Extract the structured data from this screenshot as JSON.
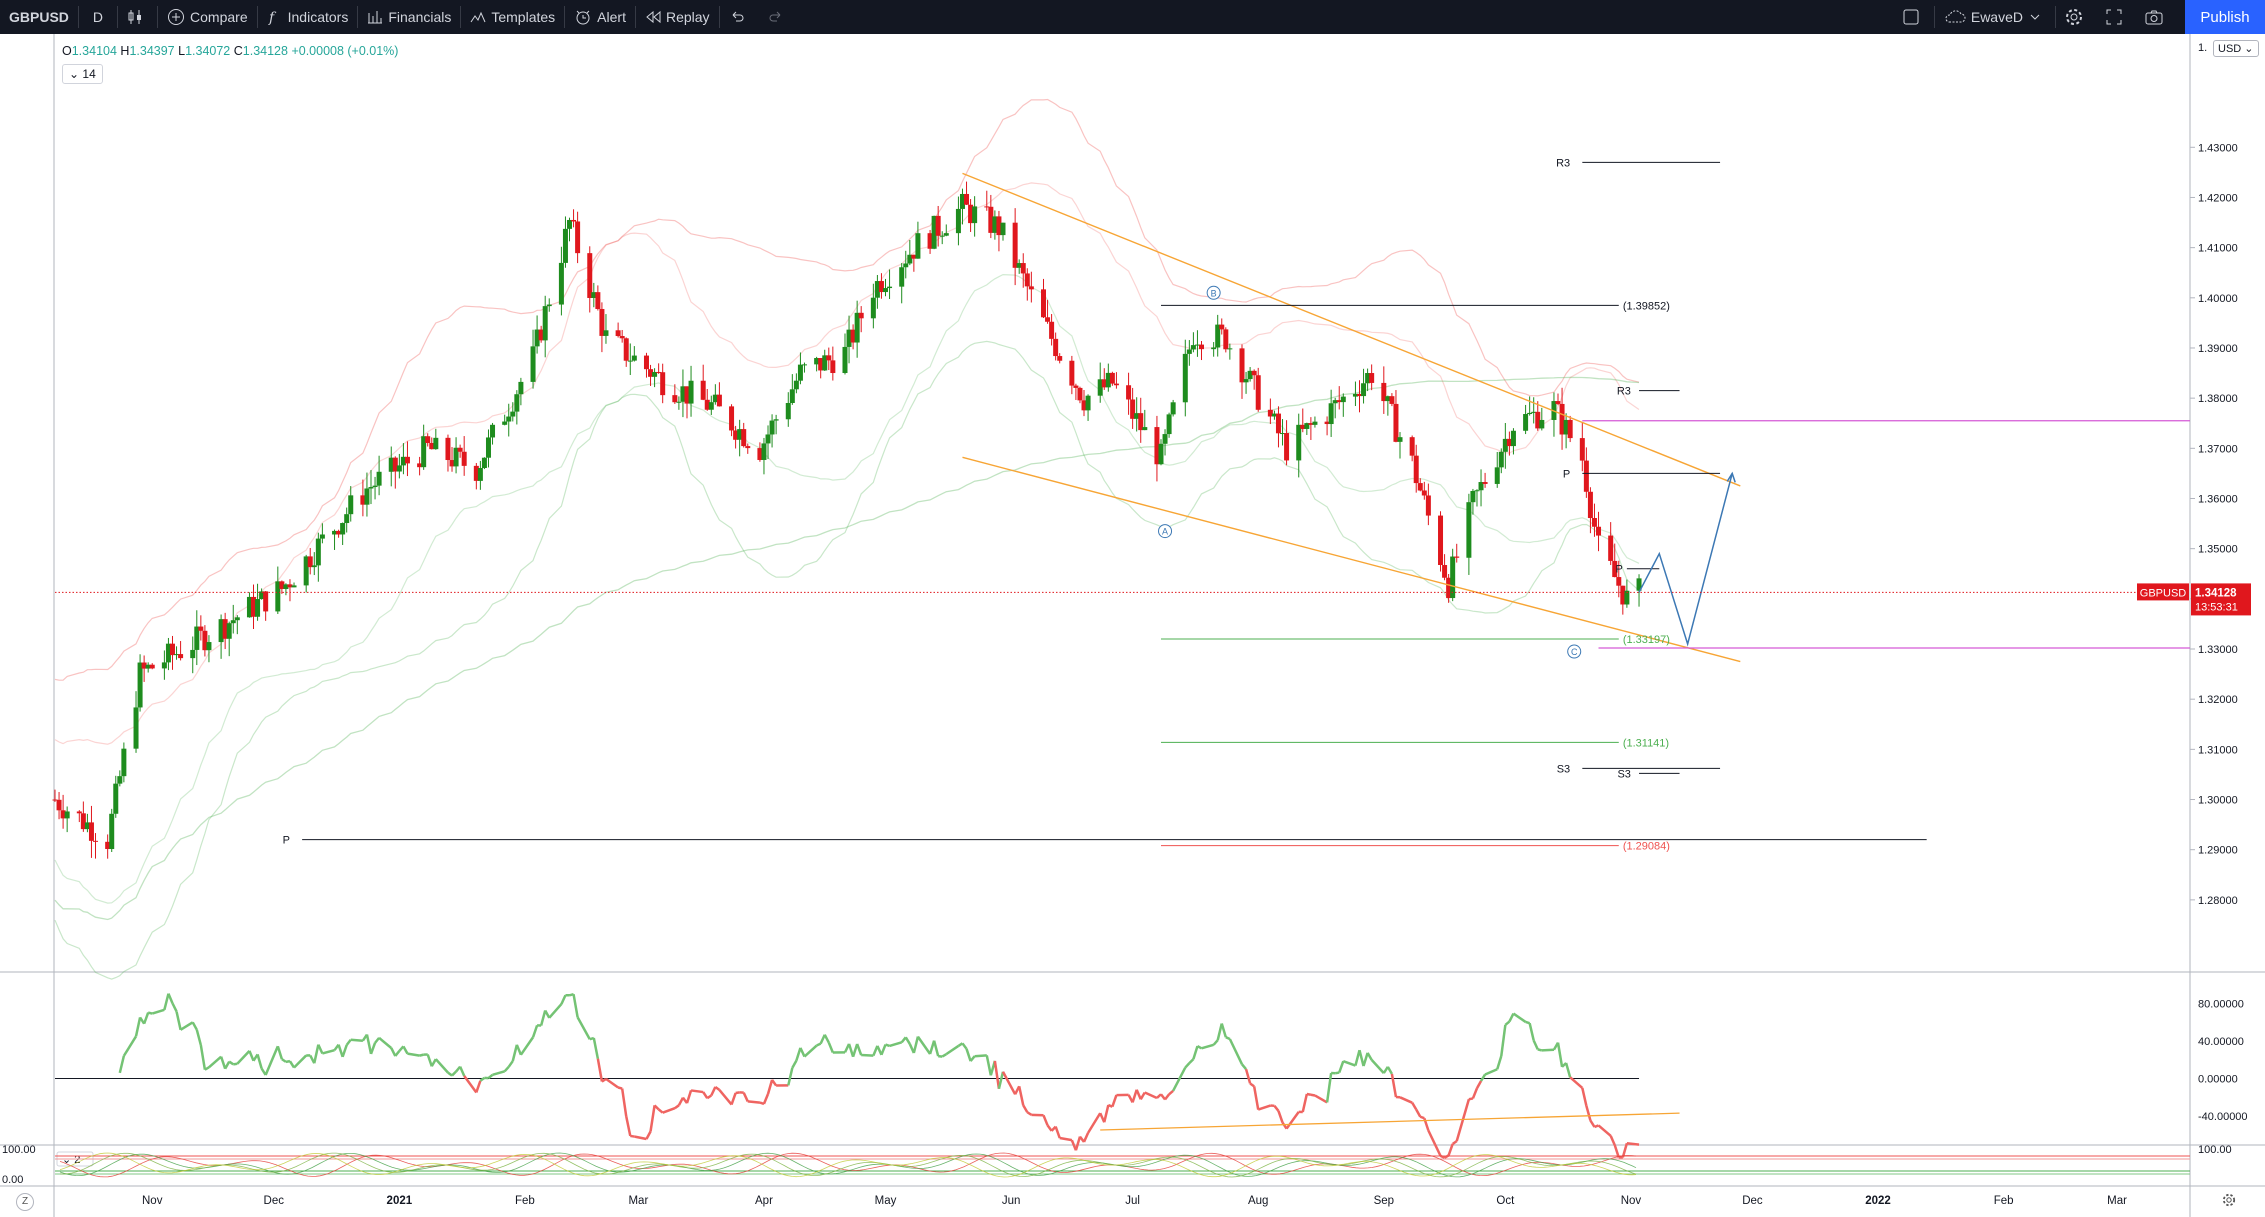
{
  "topbar": {
    "symbol": "GBPUSD",
    "interval": "D",
    "compare": "Compare",
    "indicators": "Indicators",
    "financials": "Financials",
    "templates": "Templates",
    "alert": "Alert",
    "replay": "Replay",
    "layout_name": "EwaveD",
    "publish": "Publish"
  },
  "legend": {
    "o": "1.34104",
    "h": "1.34397",
    "l": "1.34072",
    "c": "1.34128",
    "change": "+0.00008 (+0.01%)",
    "indicator_badge": "14"
  },
  "price_axis": {
    "currency": "USD",
    "top_label": "1.",
    "ticks": [
      "1.43000",
      "1.42000",
      "1.41000",
      "1.40000",
      "1.39000",
      "1.38000",
      "1.37000",
      "1.36000",
      "1.35000",
      "1.34000",
      "1.33000",
      "1.32000",
      "1.31000",
      "1.30000",
      "1.29000",
      "1.28000"
    ],
    "last_symbol": "GBPUSD",
    "last_price": "1.34128",
    "countdown": "13:53:31"
  },
  "time_axis": [
    "Nov",
    "Dec",
    "2021",
    "Feb",
    "Mar",
    "Apr",
    "May",
    "Jun",
    "Jul",
    "Aug",
    "Sep",
    "Oct",
    "Nov",
    "Dec",
    "2022",
    "Feb",
    "Mar"
  ],
  "annotations": {
    "wave_labels": [
      "A",
      "B",
      "C"
    ],
    "fib_levels": [
      "(1.39852)",
      "(1.33197)",
      "(1.31141)",
      "(1.29084)"
    ],
    "pivot_labels": [
      "R3",
      "R3",
      "P",
      "P",
      "P",
      "S3",
      "S3"
    ]
  },
  "rsi_axis": [
    "80.00000",
    "40.00000",
    "0.00000",
    "-40.00000"
  ],
  "stoch_axis": {
    "left_top": "100.00",
    "left_bottom": "0.00",
    "right_top": "100.00",
    "badge": "2"
  },
  "controls": {
    "zoom_label": "Z",
    "settings_icon": "gear-icon"
  },
  "colors": {
    "up": "#1e8c1e",
    "down": "#e0171d",
    "channel": "#f7a535",
    "projection": "#3c78b4",
    "magenta": "#d55ad6",
    "rsi_up": "#74c374",
    "rsi_down": "#ef6461",
    "price_tag": "#e0171d"
  },
  "chart_data": {
    "type": "candlestick",
    "x_range": [
      "2020-10-20",
      "2022-03-31"
    ],
    "ylim": [
      1.272,
      1.447
    ],
    "series": [
      {
        "name": "GBPUSD",
        "close_path": [
          [
            "2020-10-20",
            1.3
          ],
          [
            "2020-11-02",
            1.292
          ],
          [
            "2020-11-10",
            1.325
          ],
          [
            "2020-12-01",
            1.335
          ],
          [
            "2020-12-15",
            1.342
          ],
          [
            "2021-01-05",
            1.362
          ],
          [
            "2021-01-20",
            1.37
          ],
          [
            "2021-02-01",
            1.366
          ],
          [
            "2021-02-15",
            1.388
          ],
          [
            "2021-02-24",
            1.415
          ],
          [
            "2021-03-05",
            1.392
          ],
          [
            "2021-03-20",
            1.383
          ],
          [
            "2021-04-01",
            1.378
          ],
          [
            "2021-04-12",
            1.37
          ],
          [
            "2021-04-22",
            1.385
          ],
          [
            "2021-05-03",
            1.389
          ],
          [
            "2021-05-10",
            1.402
          ],
          [
            "2021-05-20",
            1.41
          ],
          [
            "2021-06-01",
            1.418
          ],
          [
            "2021-06-10",
            1.414
          ],
          [
            "2021-06-21",
            1.395
          ],
          [
            "2021-07-01",
            1.38
          ],
          [
            "2021-07-08",
            1.383
          ],
          [
            "2021-07-20",
            1.368
          ],
          [
            "2021-07-28",
            1.393
          ],
          [
            "2021-08-05",
            1.392
          ],
          [
            "2021-08-20",
            1.37
          ],
          [
            "2021-08-30",
            1.377
          ],
          [
            "2021-09-10",
            1.385
          ],
          [
            "2021-09-20",
            1.367
          ],
          [
            "2021-09-29",
            1.343
          ],
          [
            "2021-10-05",
            1.359
          ],
          [
            "2021-10-15",
            1.375
          ],
          [
            "2021-10-25",
            1.378
          ],
          [
            "2021-11-01",
            1.368
          ],
          [
            "2021-11-05",
            1.35
          ],
          [
            "2021-11-12",
            1.34
          ],
          [
            "2021-11-15",
            1.3413
          ]
        ]
      }
    ]
  }
}
